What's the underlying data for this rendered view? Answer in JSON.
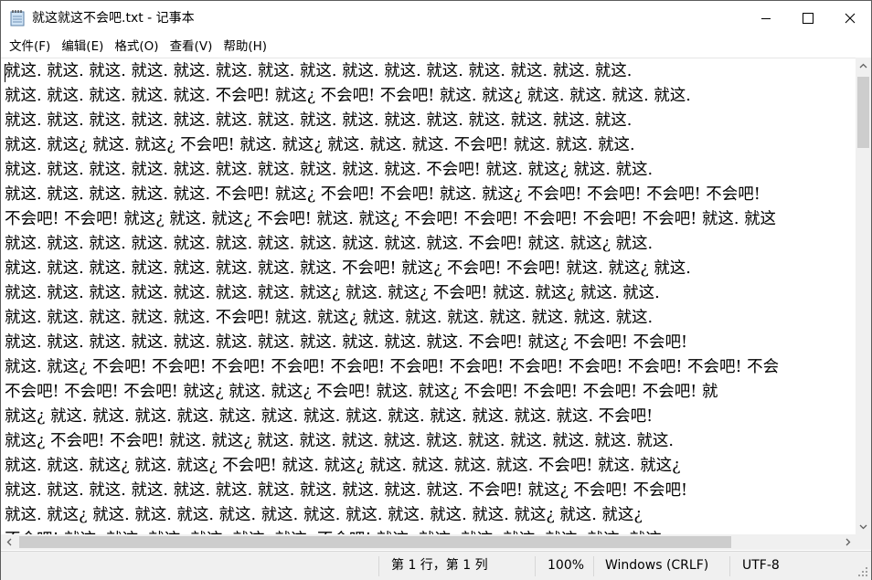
{
  "window": {
    "title": "就这就这不会吧.txt - 记事本"
  },
  "menu": [
    "文件(F)",
    "编辑(E)",
    "格式(O)",
    "查看(V)",
    "帮助(H)"
  ],
  "lines": [
    "就这. 就这. 就这. 就这. 就这. 就这. 就这. 就这. 就这. 就这. 就这. 就这. 就这. 就这. 就这.",
    "就这. 就这. 就这. 就这. 就这. 不会吧! 就这¿ 不会吧! 不会吧! 就这. 就这¿ 就这. 就这. 就这. 就这.",
    "就这. 就这. 就这. 就这. 就这. 就这. 就这. 就这. 就这. 就这. 就这. 就这. 就这. 就这. 就这.",
    "就这. 就这¿ 就这. 就这¿ 不会吧! 就这. 就这¿ 就这. 就这. 就这. 不会吧! 就这. 就这. 就这.",
    "就这. 就这. 就这. 就这. 就这. 就这. 就这. 就这. 就这. 就这. 不会吧! 就这. 就这¿ 就这. 就这.",
    "就这. 就这. 就这. 就这. 就这. 不会吧! 就这¿ 不会吧! 不会吧! 就这. 就这¿ 不会吧! 不会吧! 不会吧! 不会吧!",
    "不会吧! 不会吧! 就这¿ 就这. 就这¿ 不会吧! 就这. 就这¿ 不会吧! 不会吧! 不会吧! 不会吧! 不会吧! 就这. 就这",
    "就这. 就这. 就这. 就这. 就这. 就这. 就这. 就这. 就这. 就这. 就这. 不会吧! 就这. 就这¿ 就这.",
    "就这. 就这. 就这. 就这. 就这. 就这. 就这. 就这. 不会吧! 就这¿ 不会吧! 不会吧! 就这. 就这¿ 就这.",
    "就这. 就这. 就这. 就这. 就这. 就这. 就这. 就这¿ 就这. 就这¿ 不会吧! 就这. 就这¿ 就这. 就这.",
    "就这. 就这. 就这. 就这. 就这. 不会吧! 就这. 就这¿ 就这. 就这. 就这. 就这. 就这. 就这. 就这.",
    "就这. 就这. 就这. 就这. 就这. 就这. 就这. 就这. 就这. 就这. 就这. 不会吧! 就这¿ 不会吧! 不会吧!",
    "就这. 就这¿ 不会吧! 不会吧! 不会吧! 不会吧! 不会吧! 不会吧! 不会吧! 不会吧! 不会吧! 不会吧! 不会吧! 不会",
    "不会吧! 不会吧! 不会吧! 就这¿ 就这. 就这¿ 不会吧! 就这. 就这¿ 不会吧! 不会吧! 不会吧! 不会吧! 就",
    "就这¿ 就这. 就这. 就这. 就这. 就这. 就这. 就这. 就这. 就这. 就这. 就这. 就这. 就这. 不会吧!",
    "就这¿ 不会吧! 不会吧! 就这. 就这¿ 就这. 就这. 就这. 就这. 就这. 就这. 就这. 就这. 就这. 就这.",
    "就这. 就这. 就这¿ 就这. 就这¿ 不会吧! 就这. 就这¿ 就这. 就这. 就这. 就这. 不会吧! 就这. 就这¿",
    "就这. 就这. 就这. 就这. 就这. 就这. 就这. 就这. 就这. 就这. 就这. 不会吧! 就这¿ 不会吧! 不会吧!",
    "就这. 就这¿ 就这. 就这. 就这. 就这. 就这. 就这. 就这. 就这. 就这. 就这. 就这¿ 就这. 就这¿",
    "不会吧! 就这. 就这. 就这. 就这. 就这. 就这. 不会吧! 就这. 就这. 就这. 就这. 就这. 就这. 就这."
  ],
  "status": {
    "position": "第 1 行，第 1 列",
    "zoom": "100%",
    "line_ending": "Windows (CRLF)",
    "encoding": "UTF-8"
  }
}
